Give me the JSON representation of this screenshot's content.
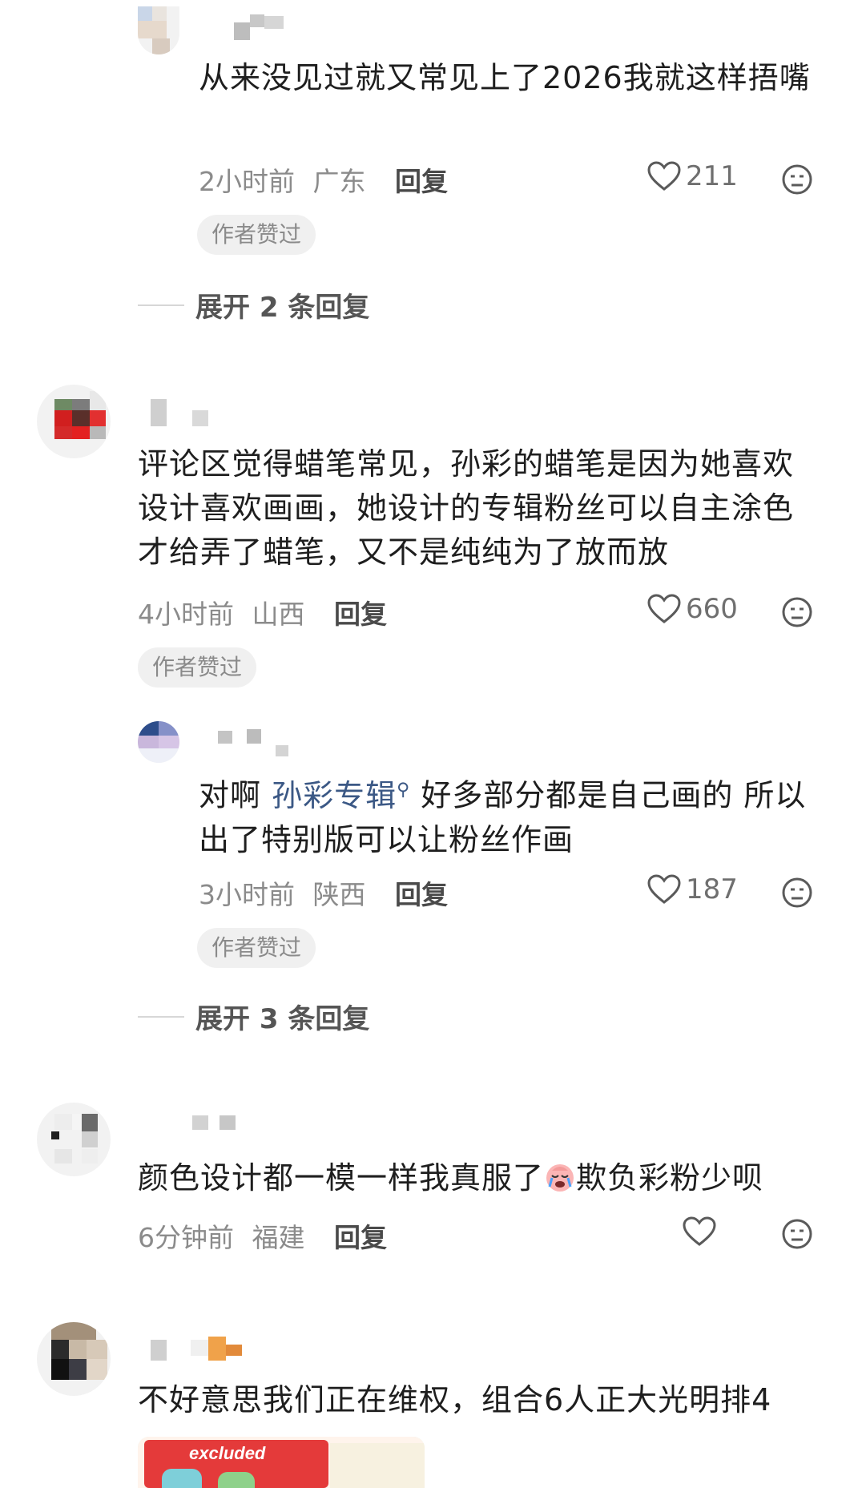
{
  "comments": [
    {
      "text": "从来没见过就又常见上了2026我就这样捂嘴",
      "time": "2小时前",
      "location": "广东",
      "reply_label": "回复",
      "likes": "211",
      "author_liked": "作者赞过",
      "expand_label": "展开 2 条回复"
    },
    {
      "text": "评论区觉得蜡笔常见，孙彩的蜡笔是因为她喜欢设计喜欢画画，她设计的专辑粉丝可以自主涂色才给弄了蜡笔，又不是纯纯为了放而放",
      "time": "4小时前",
      "location": "山西",
      "reply_label": "回复",
      "likes": "660",
      "author_liked": "作者赞过",
      "reply": {
        "text_before": "对啊 ",
        "mention": "孙彩专辑",
        "text_after": " 好多部分都是自己画的 所以出了特别版可以让粉丝作画",
        "time": "3小时前",
        "location": "陕西",
        "reply_label": "回复",
        "likes": "187",
        "author_liked": "作者赞过"
      },
      "expand_label": "展开 3 条回复"
    },
    {
      "text_before": "颜色设计都一模一样我真服了",
      "emoji": "crying-face-emoji",
      "text_after": "欺负彩粉少呗",
      "time": "6分钟前",
      "location": "福建",
      "reply_label": "回复",
      "likes": ""
    },
    {
      "text": "不好意思我们正在维权，组合6人正大光明排4",
      "image_caption": "excluded"
    }
  ],
  "icons": {
    "like": "heart-outline-icon",
    "dislike": "dislike-face-icon",
    "mention": "search-magnifier-icon"
  },
  "colors": {
    "mention": "#3b5885",
    "meta": "#8b8b8b",
    "badge_bg": "#f0f0f0"
  }
}
